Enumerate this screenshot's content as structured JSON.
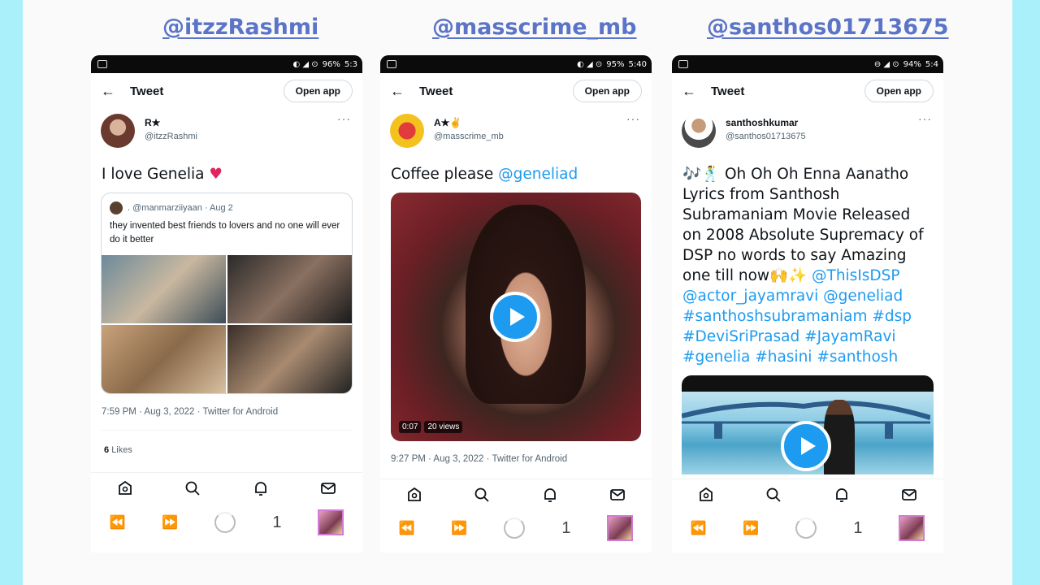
{
  "columns": [
    {
      "handle": "@itzzRashmi",
      "status": {
        "battery": "96%",
        "time": "5:3"
      },
      "header": {
        "title": "Tweet",
        "open_app": "Open app",
        "more": "···"
      },
      "author": {
        "name": "R★",
        "username": "@itzzRashmi"
      },
      "text": "I love Genelia ",
      "text_emoji": "♥",
      "quote": {
        "header": ". @manmarziiyaan · Aug 2",
        "text": "they invented best friends to lovers and no one will ever do it better"
      },
      "meta": "7:59 PM · Aug 3, 2022 · Twitter for Android",
      "likes": {
        "count": "6",
        "label": "Likes"
      },
      "tab_count": "1"
    },
    {
      "handle": "@masscrime_mb",
      "status": {
        "battery": "95%",
        "time": "5:40"
      },
      "header": {
        "title": "Tweet",
        "open_app": "Open app",
        "more": "···"
      },
      "author": {
        "name": "A★✌",
        "username": "@masscrime_mb"
      },
      "text": "Coffee please ",
      "mention": "@geneliad",
      "video": {
        "duration": "0:07",
        "views": "20 views"
      },
      "meta": "9:27 PM · Aug 3, 2022 · Twitter for Android",
      "tab_count": "1"
    },
    {
      "handle": "@santhos01713675",
      "status": {
        "battery": "94%",
        "time": "5:4"
      },
      "header": {
        "title": "Tweet",
        "open_app": "Open app",
        "more": "···"
      },
      "author": {
        "name": "santhoshkumar",
        "username": "@santhos01713675"
      },
      "text_emoji": "🎶🕺",
      "text": " Oh Oh Oh Enna Aanatho Lyrics from Santhosh Subramaniam Movie Released on 2008 Absolute Supremacy of DSP no words to say Amazing one till now",
      "text_emoji2": "🙌✨",
      "links": "@ThisIsDSP @actor_jayamravi @geneliad #santhoshsubramaniam #dsp #DeviSriPrasad #JayamRavi #genelia #hasini #santhosh",
      "tab_count": "1"
    }
  ],
  "icons": [
    "home-icon",
    "search-icon",
    "bell-icon",
    "mail-icon",
    "rewind-icon",
    "forward-icon"
  ],
  "colors": {
    "background": "#aaf0fb",
    "handle": "#5b74c7",
    "link": "#1d9bf0",
    "heart": "#e0245e"
  }
}
